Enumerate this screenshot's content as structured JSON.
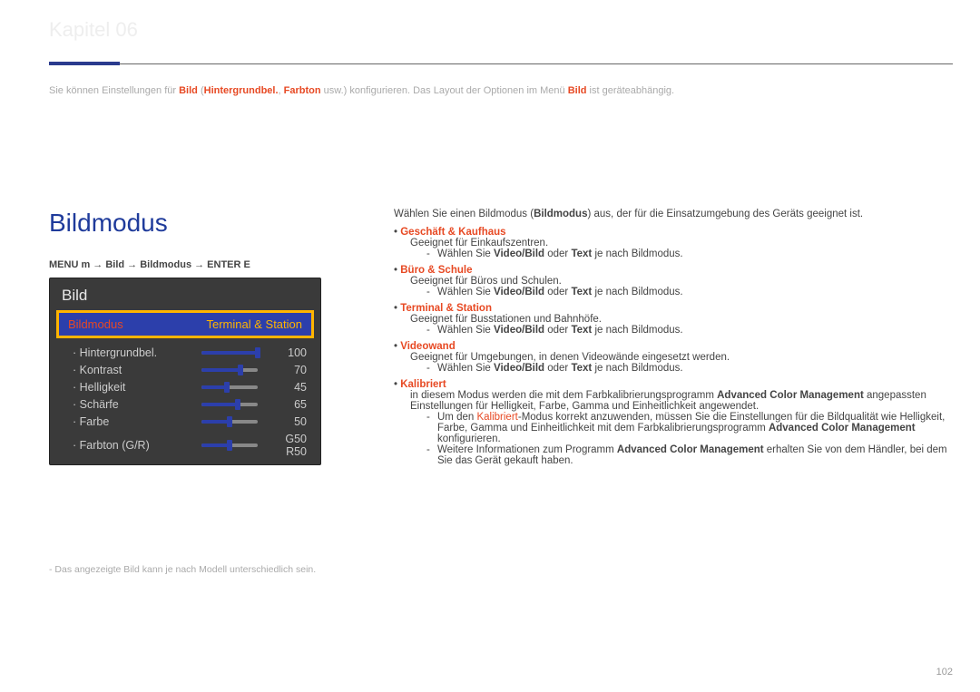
{
  "chapterHint": "Kapitel 06",
  "intro": {
    "a": "Sie können Einstellungen für ",
    "b": "Bild",
    "c": " (",
    "d": "Hintergrundbel.",
    "e": ", ",
    "f": "Farbton",
    "g": " usw.) konfigurieren.  Das Layout der Optionen im Menü ",
    "h": "Bild",
    "i": " ist geräteabhängig."
  },
  "bigtitle": "Bildmodus",
  "menuline": "MENU m  →  Bild  →  Bildmodus  →  ENTER E",
  "screenshot": {
    "title": "Bild",
    "sel_label": "Bildmodus",
    "sel_value": "Terminal & Station",
    "rows": [
      {
        "label": "Hintergrundbel.",
        "value": "100",
        "fill": 100
      },
      {
        "label": "Kontrast",
        "value": "70",
        "fill": 70
      },
      {
        "label": "Helligkeit",
        "value": "45",
        "fill": 45
      },
      {
        "label": "Schärfe",
        "value": "65",
        "fill": 65
      },
      {
        "label": "Farbe",
        "value": "50",
        "fill": 50
      },
      {
        "label": "Farbton (G/R)",
        "value": "G50       R50",
        "fill": 50
      }
    ]
  },
  "footnote": "-   Das angezeigte Bild kann je nach Modell unterschiedlich sein.",
  "lead_a": "Wählen Sie einen Bildmodus (",
  "lead_b": "Bildmodus",
  "lead_c": ") aus, der für die Einsatzumgebung des Geräts geeignet ist.",
  "items": [
    {
      "ht": "•  ",
      "mode": "Geschäft & Kaufhaus",
      "desc": "Geeignet für Einkaufszentren.",
      "sub": [
        "Wählen Sie ",
        "Video/Bild",
        " oder ",
        "Text",
        " je nach Bildmodus."
      ]
    },
    {
      "ht": "•  ",
      "mode": "Büro & Schule",
      "desc": "Geeignet für Büros und Schulen.",
      "sub": [
        "Wählen Sie ",
        "Video/Bild",
        " oder ",
        "Text",
        " je nach Bildmodus."
      ]
    },
    {
      "ht": "•  ",
      "mode": "Terminal & Station",
      "desc": "Geeignet für Busstationen und Bahnhöfe.",
      "sub": [
        "Wählen Sie ",
        "Video/Bild",
        " oder ",
        "Text",
        " je nach Bildmodus."
      ]
    },
    {
      "ht": "•  ",
      "mode": "Videowand",
      "desc": "Geeignet für Umgebungen, in denen Videowände eingesetzt werden.",
      "sub": [
        "Wählen Sie ",
        "Video/Bild",
        " oder ",
        "Text",
        " je nach Bildmodus."
      ]
    }
  ],
  "calib": {
    "ht": "•  ",
    "mode": "Kalibriert",
    "desc_a": "in diesem Modus werden die mit dem Farbkalibrierungsprogramm ",
    "desc_b": "Advanced Color Management",
    "desc_c": " angepassten Einstellungen für Helligkeit, Farbe, Gamma und Einheitlichkeit angewendet.",
    "sub1_a": "Um den ",
    "sub1_b": "Kalibriert",
    "sub1_c": "-Modus korrekt anzuwenden, müssen Sie die Einstellungen für die Bildqualität wie Helligkeit, Farbe, Gamma und Einheitlichkeit mit dem Farbkalibrierungsprogramm ",
    "sub1_d": "Advanced Color Management",
    "sub1_e": " konfigurieren.",
    "sub2_a": "Weitere Informationen zum Programm ",
    "sub2_b": "Advanced Color Management",
    "sub2_c": " erhalten Sie von dem Händler, bei dem Sie das Gerät gekauft haben."
  },
  "page": "102"
}
